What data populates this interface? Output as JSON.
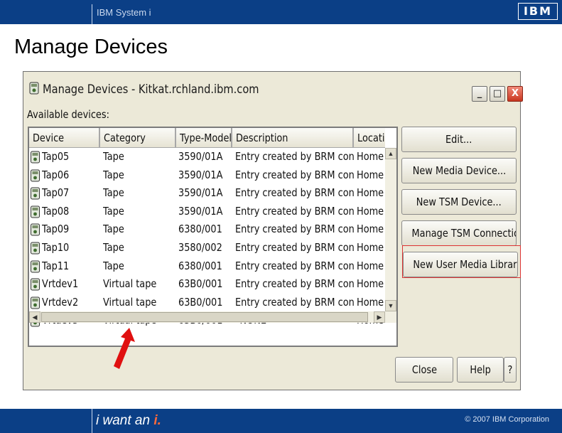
{
  "banner": {
    "title": "IBM System i",
    "logo": "IBM"
  },
  "slide": {
    "title": "Manage Devices"
  },
  "window": {
    "title": "Manage Devices - Kitkat.rchland.ibm.com",
    "minimize_glyph": "_",
    "maximize_glyph": "□",
    "close_glyph": "X",
    "available_label": "Available devices:"
  },
  "table": {
    "columns": [
      "Device",
      "Category",
      "Type-Model",
      "Description",
      "Locatic"
    ],
    "rows": [
      [
        "Tap05",
        "Tape",
        "3590/01A",
        "Entry created by BRM config...",
        "Home"
      ],
      [
        "Tap06",
        "Tape",
        "3590/01A",
        "Entry created by BRM config...",
        "Home"
      ],
      [
        "Tap07",
        "Tape",
        "3590/01A",
        "Entry created by BRM config...",
        "Home"
      ],
      [
        "Tap08",
        "Tape",
        "3590/01A",
        "Entry created by BRM config...",
        "Home"
      ],
      [
        "Tap09",
        "Tape",
        "6380/001",
        "Entry created by BRM config...",
        "Home"
      ],
      [
        "Tap10",
        "Tape",
        "3580/002",
        "Entry created by BRM config...",
        "Home"
      ],
      [
        "Tap11",
        "Tape",
        "6380/001",
        "Entry created by BRM config...",
        "Home"
      ],
      [
        "Vrtdev1",
        "Virtual tape",
        "63B0/001",
        "Entry created by BRM config...",
        "Home"
      ],
      [
        "Vrtdev2",
        "Virtual tape",
        "63B0/001",
        "Entry created by BRM config...",
        "Home"
      ],
      [
        "Vrtdev3",
        "Virtual tape",
        "63B0/001",
        "*NONE",
        "Home"
      ]
    ]
  },
  "buttons": {
    "edit": "Edit...",
    "new_media_device": "New Media Device...",
    "new_tsm_device": "New TSM Device...",
    "manage_tsm_connections": "Manage TSM Connections",
    "new_user_media_library": "New User Media Library...",
    "close": "Close",
    "help": "Help",
    "whats_this": "?"
  },
  "footer": {
    "tagline_prefix": "i want an ",
    "tagline_mark": "i.",
    "copyright": "© 2007 IBM Corporation"
  },
  "colors": {
    "banner": "#0b3f86",
    "highlight": "#dd3333",
    "arrow": "#e01010",
    "window_bg": "#ece9d8"
  }
}
